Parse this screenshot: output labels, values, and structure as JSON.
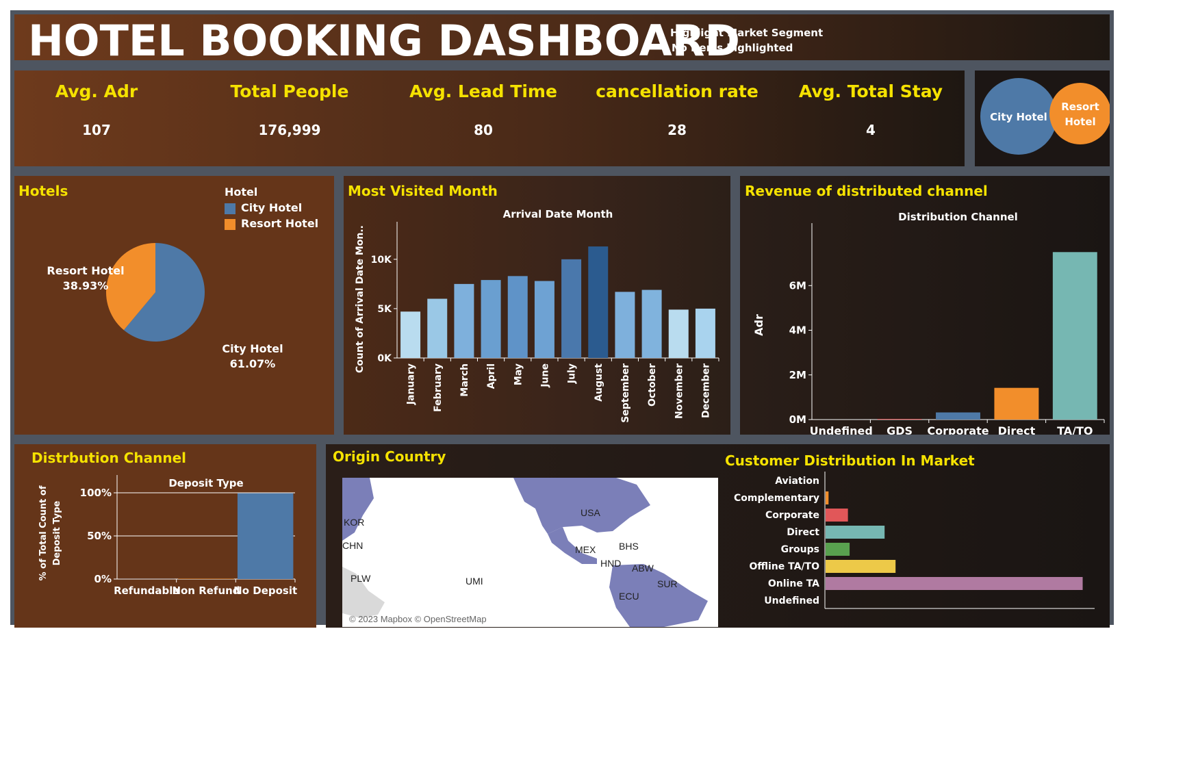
{
  "header": {
    "title": "HOTEL BOOKING DASHBOARD",
    "highlight_title": "Highlight Market Segment",
    "highlight_value": "No items highlighted"
  },
  "kpis": [
    {
      "label": "Avg. Adr",
      "value": "107"
    },
    {
      "label": "Total People",
      "value": "176,999"
    },
    {
      "label": "Avg. Lead Time",
      "value": "80"
    },
    {
      "label": "cancellation rate",
      "value": "28"
    },
    {
      "label": "Avg. Total Stay",
      "value": "4"
    }
  ],
  "hotel_buttons": {
    "city": "City Hotel",
    "resort_line1": "Resort",
    "resort_line2": "Hotel"
  },
  "colors": {
    "city": "#4e79a7",
    "resort": "#f28e2b",
    "accent": "#f5e200"
  },
  "chart_data": [
    {
      "type": "pie",
      "panel_title": "Hotels",
      "legend_title": "Hotel",
      "slices": [
        {
          "name": "City Hotel",
          "value": 61.07,
          "label": "61.07%",
          "color": "#4e79a7"
        },
        {
          "name": "Resort Hotel",
          "value": 38.93,
          "label": "38.93%",
          "color": "#f28e2b"
        }
      ]
    },
    {
      "type": "bar",
      "panel_title": "Most Visited Month",
      "title": "Arrival Date Month",
      "ylabel": "Count of Arrival Date Mon..",
      "ylim": [
        0,
        12000
      ],
      "yticks": [
        {
          "v": 0,
          "label": "0K"
        },
        {
          "v": 5000,
          "label": "5K"
        },
        {
          "v": 10000,
          "label": "10K"
        }
      ],
      "categories": [
        "January",
        "February",
        "March",
        "April",
        "May",
        "June",
        "July",
        "August",
        "September",
        "October",
        "November",
        "December"
      ],
      "values": [
        4700,
        6000,
        7500,
        7900,
        8300,
        7800,
        10000,
        11300,
        6700,
        6900,
        4900,
        5000
      ],
      "colors": [
        "#b9dcef",
        "#9ac8e6",
        "#7eb0dc",
        "#6a9fd0",
        "#5f93c8",
        "#6ea2d3",
        "#4a78ac",
        "#2b5b8f",
        "#7eb0dc",
        "#80b3dd",
        "#b9dcef",
        "#a9d3ee"
      ]
    },
    {
      "type": "bar",
      "panel_title": "Revenue of distributed channel",
      "title": "Distribution Channel",
      "ylabel": "Adr",
      "ylim": [
        0,
        8000000
      ],
      "yticks": [
        {
          "v": 0,
          "label": "0M"
        },
        {
          "v": 2000000,
          "label": "2M"
        },
        {
          "v": 4000000,
          "label": "4M"
        },
        {
          "v": 6000000,
          "label": "6M"
        }
      ],
      "categories": [
        "Undefined",
        "GDS",
        "Corporate",
        "Direct",
        "TA/TO"
      ],
      "values": [
        1000,
        30000,
        320000,
        1420000,
        7500000
      ],
      "colors": [
        "#4e79a7",
        "#e15759",
        "#4e79a7",
        "#f28e2b",
        "#76b7b2"
      ]
    },
    {
      "type": "bar",
      "panel_title": "Distrbution Channel",
      "title": "Deposit Type",
      "ylabel_line1": "% of Total Count of",
      "ylabel_line2": "Deposit Type",
      "ylim": [
        0,
        100
      ],
      "yticks": [
        {
          "v": 0,
          "label": "0%"
        },
        {
          "v": 50,
          "label": "50%"
        },
        {
          "v": 100,
          "label": "100%"
        }
      ],
      "categories": [
        "Refundable",
        "Non Refund",
        "No Deposit"
      ],
      "values": [
        0.1,
        0.4,
        99.5
      ],
      "colors": [
        "#4e79a7",
        "#f28e2b",
        "#4e79a7"
      ]
    },
    {
      "type": "bar",
      "orientation": "horizontal",
      "panel_title": "Customer Distribution In Market",
      "categories": [
        "Aviation",
        "Complementary",
        "Corporate",
        "Direct",
        "Groups",
        "Offline TA/TO",
        "Online TA",
        "Undefined"
      ],
      "values": [
        0,
        700,
        5300,
        14000,
        5700,
        16600,
        61000,
        0
      ],
      "xlim": [
        0,
        64000
      ],
      "colors": [
        "#4e79a7",
        "#f28e2b",
        "#e15759",
        "#76b7b2",
        "#59a14f",
        "#edc948",
        "#b07aa1",
        "#ff9da7"
      ]
    }
  ],
  "map": {
    "panel_title": "Origin Country",
    "attribution": "© 2023 Mapbox © OpenStreetMap",
    "labels": [
      "USA",
      "MEX",
      "BHS",
      "HND",
      "ABW",
      "SUR",
      "ECU",
      "UMI",
      "PLW",
      "KOR",
      "CHN"
    ]
  }
}
